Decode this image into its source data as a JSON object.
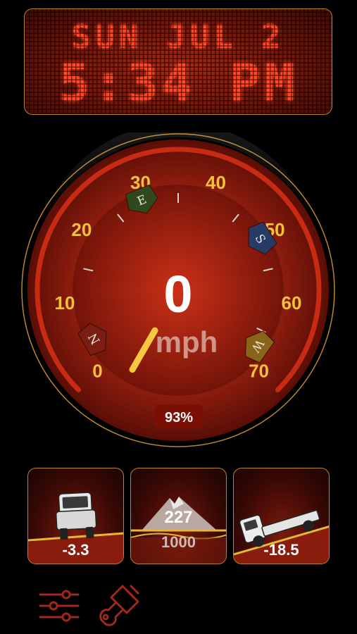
{
  "datetime": {
    "date_text": "SUN JUL 2",
    "time_text": "5:34 PM"
  },
  "speedometer": {
    "speed": "0",
    "unit": "mph",
    "battery": "93%",
    "needle_value": 0,
    "scale_min": 0,
    "scale_max": 70,
    "tick_labels": [
      "0",
      "10",
      "20",
      "30",
      "40",
      "50",
      "60",
      "70"
    ],
    "compass": [
      {
        "letter": "N",
        "color": "#7a1e14"
      },
      {
        "letter": "E",
        "color": "#2e4a1c"
      },
      {
        "letter": "S",
        "color": "#283a66"
      },
      {
        "letter": "W",
        "color": "#8a6418"
      }
    ],
    "colors": {
      "tick_label": "#f2c23a",
      "needle": "#f5c842",
      "rim": "#c82a12"
    }
  },
  "tiles": {
    "roll": {
      "value": "-3.3",
      "icon": "truck-front-icon"
    },
    "elevation": {
      "value": "227",
      "reference": "1000",
      "icon": "mountain-icon"
    },
    "pitch": {
      "value": "-18.5",
      "icon": "truck-side-icon"
    }
  },
  "toolbar": {
    "settings_icon": "sliders-icon",
    "theme_icon": "paintbrush-icon",
    "icon_color": "#a0281c"
  }
}
